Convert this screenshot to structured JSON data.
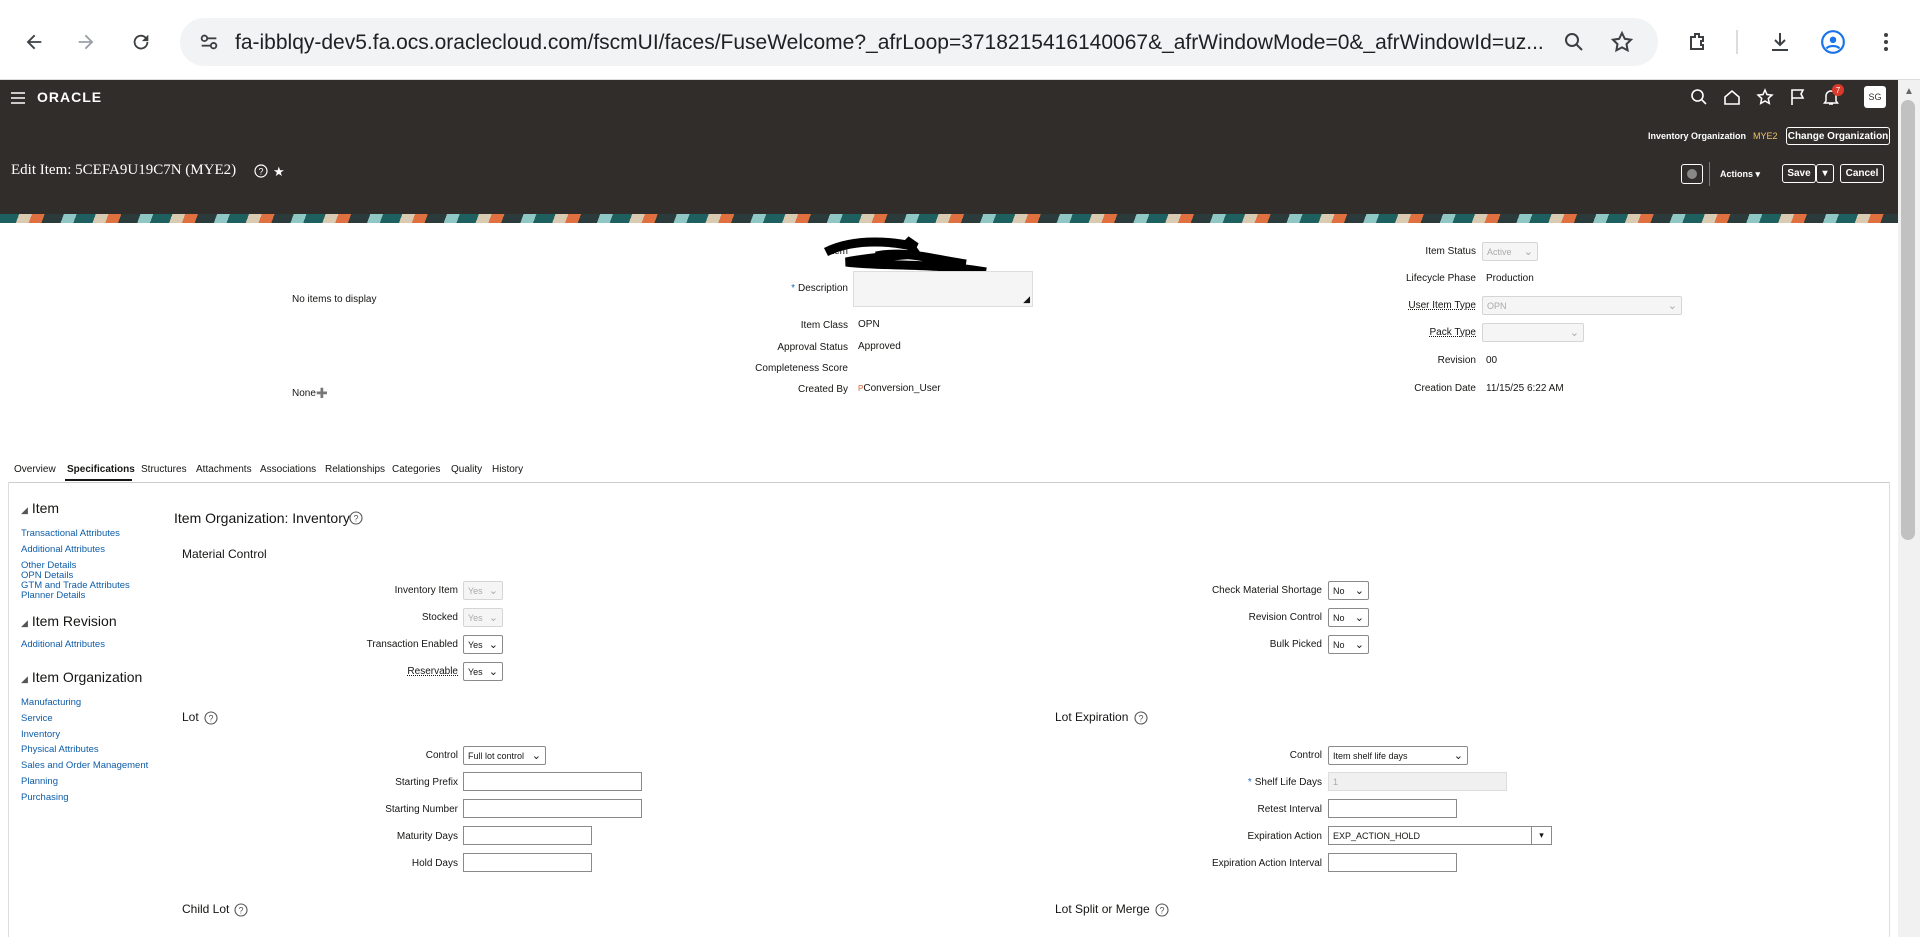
{
  "browser": {
    "url": "fa-ibblqy-dev5.fa.ocs.oraclecloud.com/fscmUI/faces/FuseWelcome?_afrLoop=3718215416140067&_afrWindowMode=0&_afrWindowId=uz..."
  },
  "header": {
    "brand": "ORACLE",
    "notification_count": "7",
    "avatar": "SG",
    "inv_org_label": "Inventory Organization",
    "inv_org_value": "MYE2",
    "change_org": "Change Organization",
    "page_title": "Edit Item: 5CEFA9U19C7N (MYE2)",
    "actions": "Actions",
    "save": "Save",
    "cancel": "Cancel"
  },
  "summary": {
    "no_items": "No items to display",
    "none": "None",
    "item_label": "Item",
    "description_label": "Description",
    "item_class_label": "Item Class",
    "item_class": "OPN",
    "approval_status_label": "Approval Status",
    "approval_status": "Approved",
    "completeness_label": "Completeness Score",
    "created_by_label": "Created By",
    "created_by": "Conversion_User",
    "item_status_label": "Item Status",
    "item_status": "Active",
    "lifecycle_label": "Lifecycle Phase",
    "lifecycle": "Production",
    "user_item_type_label": "User Item Type",
    "user_item_type": "OPN",
    "pack_type_label": "Pack Type",
    "revision_label": "Revision",
    "revision": "00",
    "creation_date_label": "Creation Date",
    "creation_date": "11/15/25 6:22 AM"
  },
  "tabs": [
    "Overview",
    "Specifications",
    "Structures",
    "Attachments",
    "Associations",
    "Relationships",
    "Categories",
    "Quality",
    "History"
  ],
  "sidebar": {
    "item_heading": "Item",
    "item_links": [
      "Transactional Attributes",
      "Additional Attributes",
      "Other Details",
      "OPN Details",
      "GTM and Trade Attributes",
      "Planner Details"
    ],
    "revision_heading": "Item Revision",
    "revision_links": [
      "Additional Attributes"
    ],
    "org_heading": "Item Organization",
    "org_links": [
      "Manufacturing",
      "Service",
      "Inventory",
      "Physical Attributes",
      "Sales and Order Management",
      "Planning",
      "Purchasing"
    ]
  },
  "main": {
    "title": "Item Organization: Inventory",
    "material_control": "Material Control",
    "inventory_item_label": "Inventory Item",
    "inventory_item": "Yes",
    "stocked_label": "Stocked",
    "stocked": "Yes",
    "transaction_enabled_label": "Transaction Enabled",
    "transaction_enabled": "Yes",
    "reservable_label": "Reservable",
    "reservable": "Yes",
    "check_shortage_label": "Check Material Shortage",
    "check_shortage": "No",
    "revision_control_label": "Revision Control",
    "revision_control": "No",
    "bulk_picked_label": "Bulk Picked",
    "bulk_picked": "No",
    "lot": "Lot",
    "lot_control_label": "Control",
    "lot_control": "Full lot control",
    "starting_prefix_label": "Starting Prefix",
    "starting_number_label": "Starting Number",
    "maturity_days_label": "Maturity Days",
    "hold_days_label": "Hold Days",
    "lot_expiration": "Lot Expiration",
    "exp_control_label": "Control",
    "exp_control": "Item shelf life days",
    "shelf_life_label": "Shelf Life Days",
    "shelf_life": "1",
    "retest_label": "Retest Interval",
    "expiration_action_label": "Expiration Action",
    "expiration_action": "EXP_ACTION_HOLD",
    "expiration_interval_label": "Expiration Action Interval",
    "child_lot": "Child Lot",
    "lot_split": "Lot Split or Merge"
  }
}
